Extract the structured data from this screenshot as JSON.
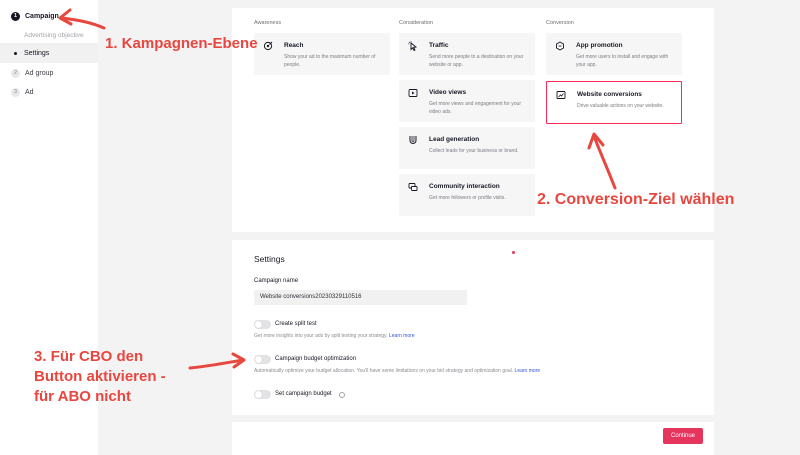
{
  "sidebar": {
    "campaign": {
      "num": "1",
      "label": "Campaign"
    },
    "objective_label": "Advertising objective",
    "settings_label": "Settings",
    "adgroup": {
      "num": "2",
      "label": "Ad group"
    },
    "ad": {
      "num": "3",
      "label": "Ad"
    }
  },
  "objectives": {
    "awareness_heading": "Awareness",
    "consideration_heading": "Consideration",
    "conversion_heading": "Conversion",
    "reach": {
      "title": "Reach",
      "desc": "Show your ad to the maximum number of people."
    },
    "traffic": {
      "title": "Traffic",
      "desc": "Send more people to a destination on your website or app."
    },
    "video_views": {
      "title": "Video views",
      "desc": "Get more views and engagement for your video ads."
    },
    "lead_generation": {
      "title": "Lead generation",
      "desc": "Collect leads for your business or brand."
    },
    "community_interaction": {
      "title": "Community interaction",
      "desc": "Get more followers or profile visits."
    },
    "app_promotion": {
      "title": "App promotion",
      "desc": "Get more users to install and engage with your app."
    },
    "website_conversions": {
      "title": "Website conversions",
      "desc": "Drive valuable actions on your website."
    }
  },
  "settings": {
    "title": "Settings",
    "campaign_name_label": "Campaign name",
    "campaign_name_value": "Website conversions20230329110516",
    "split_test_label": "Create split test",
    "split_test_help": "Get more insights into your ads by split testing your strategy.",
    "learn_more": "Learn more",
    "cbo_label": "Campaign budget optimization",
    "cbo_help": "Automatically optimize your budget allocation. You'll have some limitations on your bid strategy and optimization goal.",
    "budget_label": "Set campaign budget"
  },
  "footer": {
    "continue_label": "Continue"
  },
  "annotations": {
    "a1": "1. Kampagnen-Ebene",
    "a2": "2. Conversion-Ziel wählen",
    "a3_line1": "3. Für CBO den",
    "a3_line2": "Button aktivieren -",
    "a3_line3": "für ABO nicht"
  },
  "colors": {
    "accent": "#fe2c55",
    "annotation": "#e8473f",
    "link": "#2c56d6"
  }
}
